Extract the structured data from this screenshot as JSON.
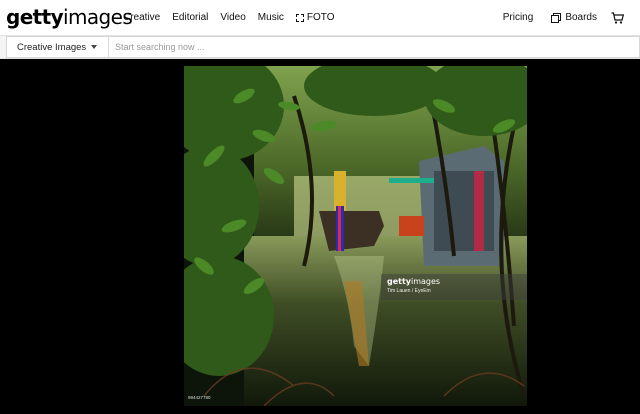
{
  "header": {
    "logo_bold": "getty",
    "logo_light": "images",
    "nav": [
      "Creative",
      "Editorial",
      "Video",
      "Music"
    ],
    "foto_label": "FOTO",
    "pricing": "Pricing",
    "boards": "Boards",
    "icons": [
      "foto-icon",
      "boards-icon",
      "cart-icon"
    ]
  },
  "search": {
    "filter_label": "Creative Images",
    "placeholder": "Start searching now ..."
  },
  "image": {
    "watermark_logo_bold": "getty",
    "watermark_logo_light": "images",
    "credit": "Tim Lauen / EyeEm",
    "id": "984427780"
  }
}
